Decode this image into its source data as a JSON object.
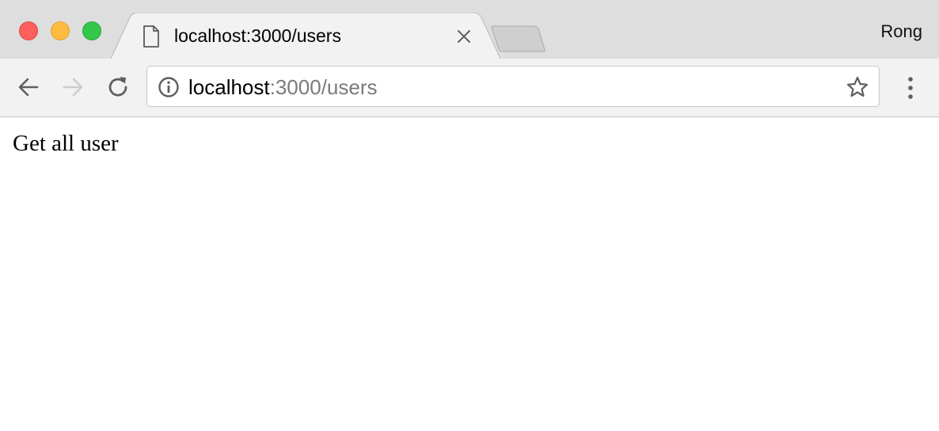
{
  "browser": {
    "tab": {
      "title": "localhost:3000/users",
      "favicon": "document-icon"
    },
    "profile_name": "Rong",
    "address_bar": {
      "host": "localhost",
      "path": ":3000/users",
      "security_icon": "info-icon",
      "bookmark_icon": "star-icon"
    },
    "toolbar_icons": [
      "back-arrow-icon",
      "forward-arrow-icon",
      "reload-icon",
      "kebab-menu-icon"
    ],
    "window_controls": {
      "close_color": "#fc605c",
      "minimize_color": "#fdbc40",
      "maximize_color": "#34c84a"
    }
  },
  "page": {
    "body_text": "Get all user"
  }
}
